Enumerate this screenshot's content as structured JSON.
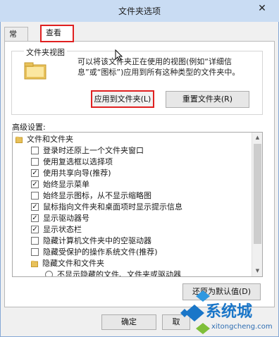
{
  "window": {
    "title": "文件夹选项",
    "close_glyph": "✕"
  },
  "tabs": [
    {
      "label": "常规",
      "active": false
    },
    {
      "label": "查看",
      "active": true
    }
  ],
  "folder_views": {
    "group_label": "文件夹视图",
    "description": "可以将该文件夹正在使用的视图(例如“详细信息”或“图标”)应用到所有这种类型的文件夹中。",
    "apply_button": "应用到文件夹(L)",
    "reset_button": "重置文件夹(R)"
  },
  "advanced": {
    "label": "高级设置:",
    "items": [
      {
        "type": "folder",
        "label": "文件和文件夹",
        "icon": "folder-icon"
      },
      {
        "type": "checkbox",
        "label": "登录时还原上一个文件夹窗口",
        "checked": false
      },
      {
        "type": "checkbox",
        "label": "使用复选框以选择项",
        "checked": false
      },
      {
        "type": "checkbox",
        "label": "使用共享向导(推荐)",
        "checked": true
      },
      {
        "type": "checkbox",
        "label": "始终显示菜单",
        "checked": true
      },
      {
        "type": "checkbox",
        "label": "始终显示图标，从不显示缩略图",
        "checked": false
      },
      {
        "type": "checkbox",
        "label": "鼠标指向文件夹和桌面项时显示提示信息",
        "checked": true
      },
      {
        "type": "checkbox",
        "label": "显示驱动器号",
        "checked": true
      },
      {
        "type": "checkbox",
        "label": "显示状态栏",
        "checked": true
      },
      {
        "type": "checkbox",
        "label": "隐藏计算机文件夹中的空驱动器",
        "checked": false
      },
      {
        "type": "checkbox",
        "label": "隐藏受保护的操作系统文件(推荐)",
        "checked": false
      },
      {
        "type": "folder",
        "label": "隐藏文件和文件夹",
        "icon": "folder-icon"
      },
      {
        "type": "radio",
        "label": "不显示隐藏的文件、文件夹或驱动器",
        "checked": false
      }
    ],
    "restore_button": "还原为默认值(D)"
  },
  "dialog_buttons": {
    "ok": "确定",
    "cancel": "取"
  },
  "watermark": {
    "text": "系统城",
    "url": "xitongcheng.com"
  },
  "colors": {
    "highlight": "#e02020",
    "titlebar": "#c9dcf3",
    "brand": "#1a76c8"
  }
}
